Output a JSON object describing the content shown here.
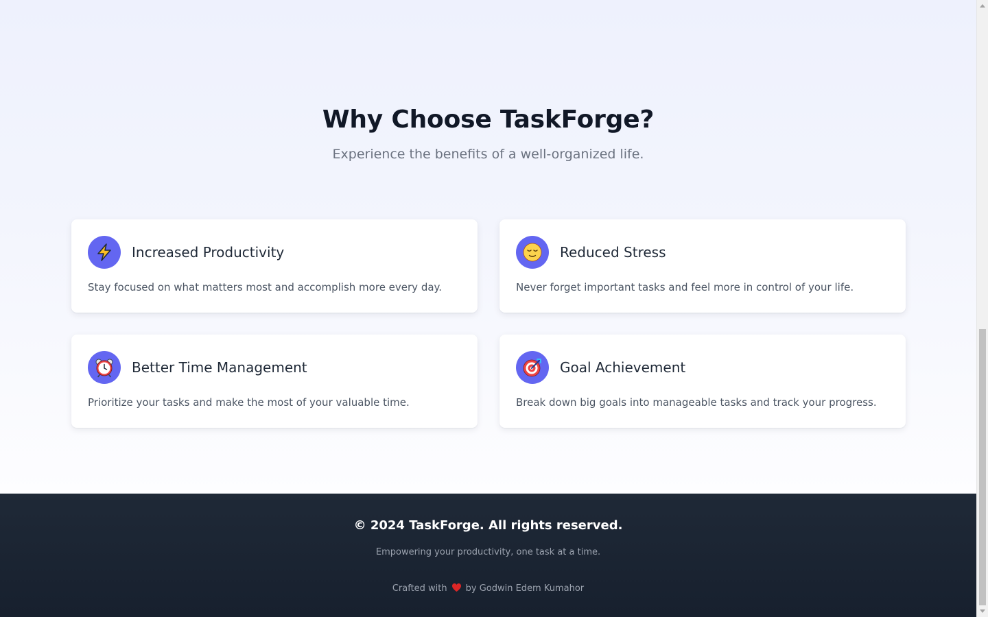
{
  "benefits": {
    "title": "Why Choose TaskForge?",
    "subtitle": "Experience the benefits of a well-organized life.",
    "accent_color": "#6366f1",
    "cards": [
      {
        "icon": "lightning-icon",
        "title": "Increased Productivity",
        "text": "Stay focused on what matters most and accomplish more every day."
      },
      {
        "icon": "relieved-face-icon",
        "title": "Reduced Stress",
        "text": "Never forget important tasks and feel more in control of your life."
      },
      {
        "icon": "alarm-clock-icon",
        "title": "Better Time Management",
        "text": "Prioritize your tasks and make the most of your valuable time."
      },
      {
        "icon": "target-icon",
        "title": "Goal Achievement",
        "text": "Break down big goals into manageable tasks and track your progress."
      }
    ]
  },
  "footer": {
    "copyright": "© 2024 TaskForge. All rights reserved.",
    "tagline": "Empowering your productivity, one task at a time.",
    "credit_prefix": "Crafted with",
    "credit_suffix": "by Godwin Edem Kumahor",
    "heart_icon": "heart-icon",
    "heart_color": "#dc2626"
  }
}
